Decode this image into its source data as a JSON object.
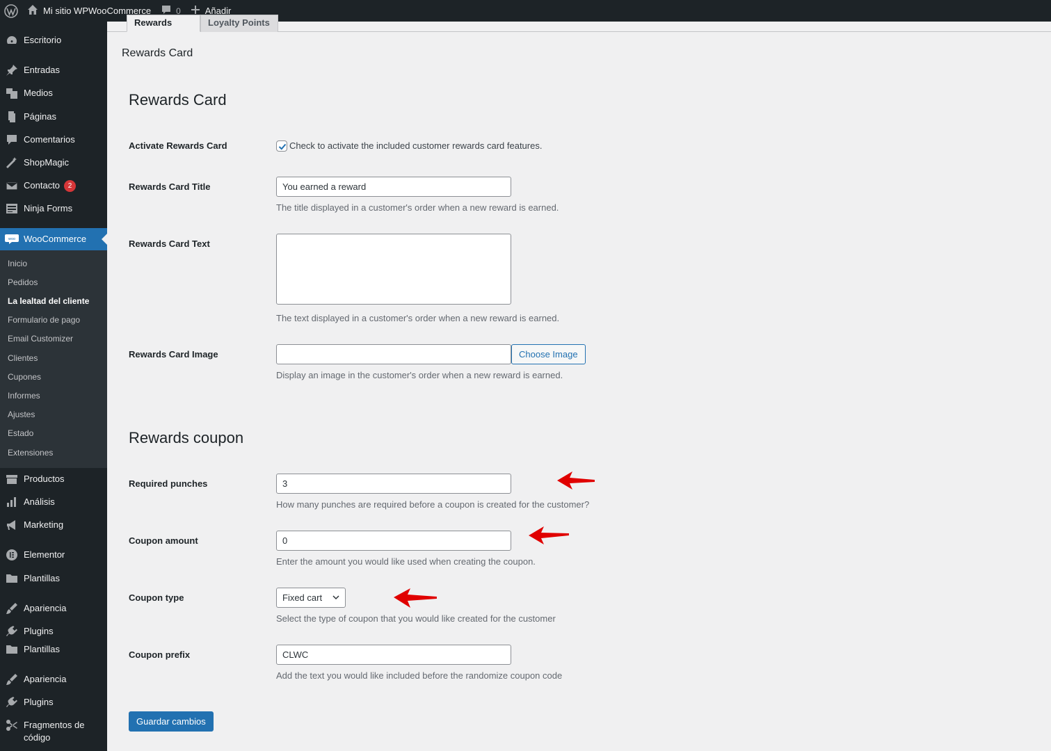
{
  "adminbar": {
    "site_name": "Mi sitio WPWooCommerce",
    "comments_count": "0",
    "new_label": "Añadir"
  },
  "sidebar": {
    "items": [
      {
        "label": "Escritorio",
        "icon": "dashboard-icon"
      },
      {
        "label": "Entradas",
        "icon": "pin-icon"
      },
      {
        "label": "Medios",
        "icon": "media-icon"
      },
      {
        "label": "Páginas",
        "icon": "page-icon"
      },
      {
        "label": "Comentarios",
        "icon": "comment-icon"
      },
      {
        "label": "ShopMagic",
        "icon": "magic-wand-icon"
      },
      {
        "label": "Contacto",
        "icon": "mail-icon",
        "badge": "2"
      },
      {
        "label": "Ninja Forms",
        "icon": "forms-icon"
      },
      {
        "label": "WooCommerce",
        "icon": "woo-icon"
      },
      {
        "label": "Productos",
        "icon": "archive-icon"
      },
      {
        "label": "Análisis",
        "icon": "bar-chart-icon"
      },
      {
        "label": "Marketing",
        "icon": "megaphone-icon"
      },
      {
        "label": "Elementor",
        "icon": "elementor-icon"
      },
      {
        "label": "Plantillas",
        "icon": "folder-icon"
      },
      {
        "label": "Apariencia",
        "icon": "brush-icon"
      },
      {
        "label": "Plugins",
        "icon": "plug-icon"
      },
      {
        "label": "Plantillas",
        "icon": "folder-icon"
      },
      {
        "label": "Apariencia",
        "icon": "brush-icon"
      },
      {
        "label": "Plugins",
        "icon": "plug-icon"
      },
      {
        "label": "Fragmentos de",
        "label2": "código",
        "icon": "scissors-icon"
      }
    ],
    "submenu": [
      "Inicio",
      "Pedidos",
      "La lealtad del cliente",
      "Formulario de pago",
      "Email Customizer",
      "Clientes",
      "Cupones",
      "Informes",
      "Ajustes",
      "Estado",
      "Extensiones"
    ]
  },
  "tabs": [
    "Rewards Card",
    "Loyalty Points"
  ],
  "page_subtitle": "Rewards Card",
  "sections": {
    "rewards_card": {
      "heading": "Rewards Card",
      "activate": {
        "label": "Activate Rewards Card",
        "checkbox_text": "Check to activate the included customer rewards card features.",
        "checked": true
      },
      "title": {
        "label": "Rewards Card Title",
        "value": "You earned a reward",
        "desc": "The title displayed in a customer's order when a new reward is earned."
      },
      "text": {
        "label": "Rewards Card Text",
        "value": "",
        "desc": "The text displayed in a customer's order when a new reward is earned."
      },
      "image": {
        "label": "Rewards Card Image",
        "value": "",
        "button": "Choose Image",
        "desc": "Display an image in the customer's order when a new reward is earned."
      }
    },
    "rewards_coupon": {
      "heading": "Rewards coupon",
      "punches": {
        "label": "Required punches",
        "value": "3",
        "desc": "How many punches are required before a coupon is created for the customer?"
      },
      "amount": {
        "label": "Coupon amount",
        "value": "0",
        "desc": "Enter the amount you would like used when creating the coupon."
      },
      "type": {
        "label": "Coupon type",
        "value": "Fixed cart",
        "desc": "Select the type of coupon that you would like created for the customer"
      },
      "prefix": {
        "label": "Coupon prefix",
        "value": "CLWC",
        "desc": "Add the text you would like included before the randomize coupon code"
      }
    }
  },
  "save_button": "Guardar cambios",
  "colors": {
    "admin_dark": "#1d2327",
    "submenu_bg": "#2c3338",
    "accent_blue": "#2271b1",
    "annotation_red": "#e00000"
  }
}
